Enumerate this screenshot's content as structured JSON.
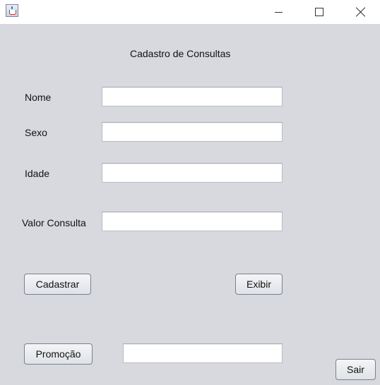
{
  "window": {
    "icon": "java-cup-icon",
    "controls": [
      "minimize-icon",
      "maximize-icon",
      "close-icon"
    ]
  },
  "form": {
    "title": "Cadastro de Consultas",
    "fields": {
      "nome": {
        "label": "Nome",
        "value": ""
      },
      "sexo": {
        "label": "Sexo",
        "value": ""
      },
      "idade": {
        "label": "Idade",
        "value": ""
      },
      "valor": {
        "label": "Valor Consulta",
        "value": ""
      },
      "promocao": {
        "value": ""
      }
    },
    "buttons": {
      "cadastrar": "Cadastrar",
      "exibir": "Exibir",
      "promocao": "Promoção",
      "sair": "Sair"
    }
  }
}
